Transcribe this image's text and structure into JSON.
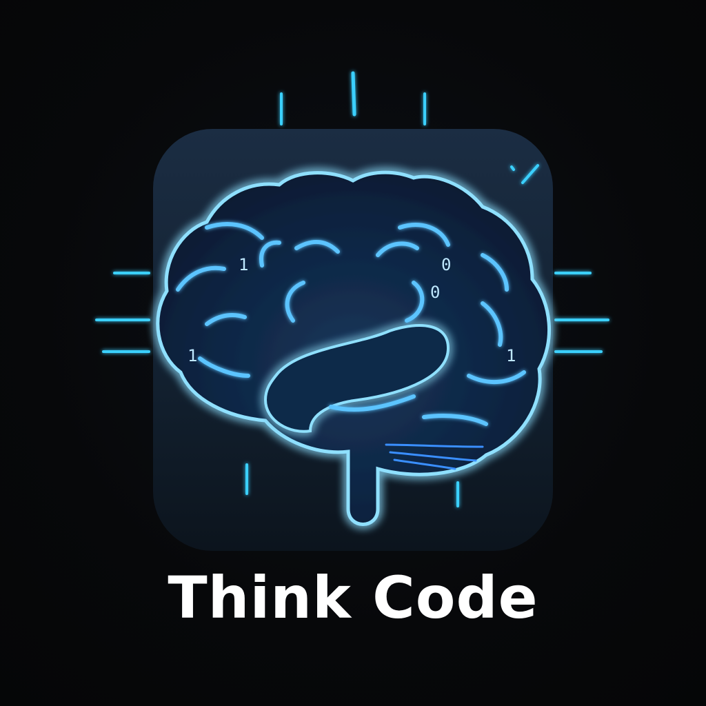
{
  "brand": {
    "name": "Think Code",
    "binary_digits": [
      "1",
      "0",
      "0",
      "1",
      "1"
    ]
  },
  "icons": {
    "emblem": "brain-icon",
    "decoration": "glow-ray-icon"
  },
  "colors": {
    "background": "#07080a",
    "tile": "#14253a",
    "brain_fill": "#0d1f36",
    "glow": "#3aa8ff",
    "outline": "#8fe0ff",
    "ray": "#3ad0ff",
    "wordmark": "#ffffff"
  }
}
